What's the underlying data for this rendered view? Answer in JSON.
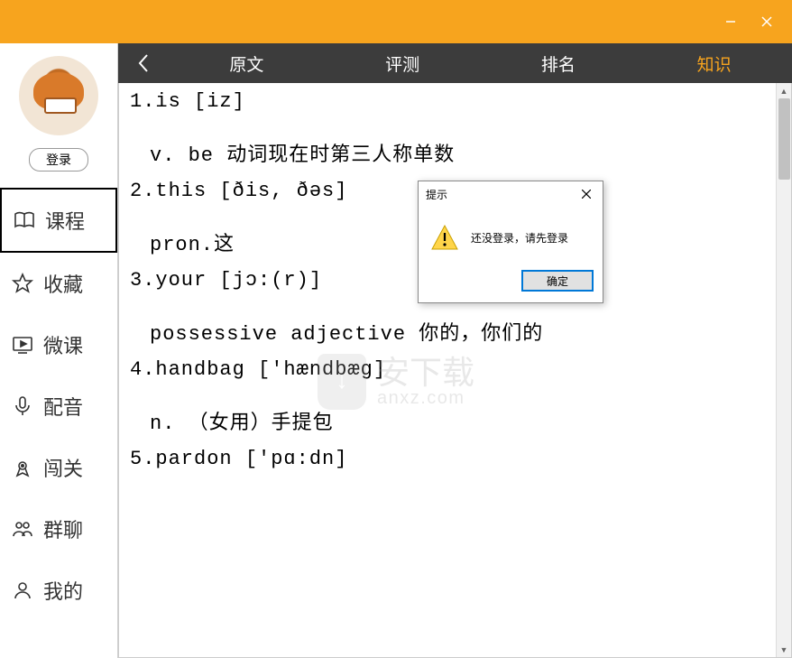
{
  "window": {
    "minimize": "–",
    "close": "×"
  },
  "sidebar": {
    "login": "登录",
    "items": [
      {
        "label": "课程",
        "icon": "book-icon"
      },
      {
        "label": "收藏",
        "icon": "star-icon"
      },
      {
        "label": "微课",
        "icon": "play-icon"
      },
      {
        "label": "配音",
        "icon": "mic-icon"
      },
      {
        "label": "闯关",
        "icon": "target-icon"
      },
      {
        "label": "群聊",
        "icon": "group-icon"
      },
      {
        "label": "我的",
        "icon": "person-icon"
      }
    ]
  },
  "tabs": {
    "back": "〈",
    "items": [
      "原文",
      "评测",
      "排名",
      "知识"
    ],
    "active": "知识"
  },
  "entries": [
    {
      "head": "1.is  [iz]",
      "def": "v. be 动词现在时第三人称单数"
    },
    {
      "head": "2.this  [ðis, ðəs]",
      "def": "pron.这"
    },
    {
      "head": "3.your  [jɔ:(r)]",
      "def": "possessive adjective 你的，你们的"
    },
    {
      "head": "4.handbag  ['hændbæg]",
      "def": "n. （女用）手提包"
    },
    {
      "head": "5.pardon  ['pɑ:dn]",
      "def": ""
    }
  ],
  "dialog": {
    "title": "提示",
    "message": "还没登录，请先登录",
    "ok": "确定"
  },
  "watermark": {
    "line1": "安下载",
    "line2": "anxz.com"
  }
}
